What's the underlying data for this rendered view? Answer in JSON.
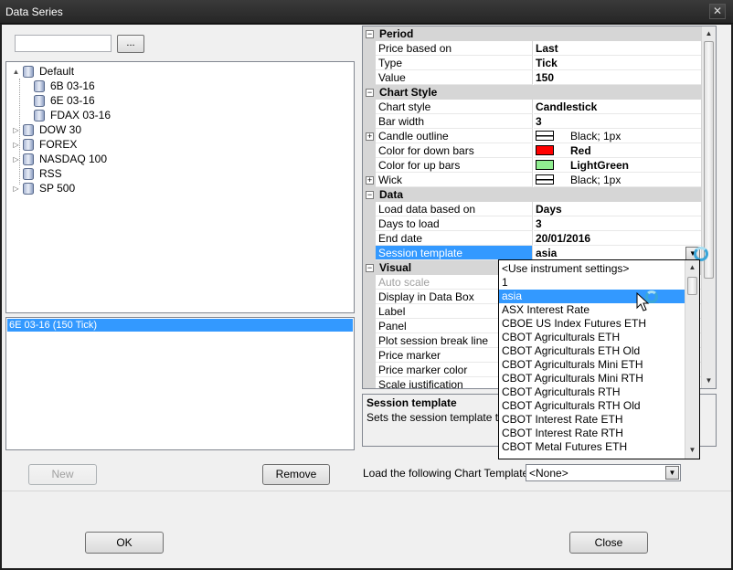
{
  "window": {
    "title": "Data Series",
    "close_glyph": "✕"
  },
  "left": {
    "search_value": "",
    "browse_label": "...",
    "tree": [
      {
        "label": "Default",
        "level": 0,
        "expander": "▲"
      },
      {
        "label": "6B 03-16",
        "level": 1,
        "expander": ""
      },
      {
        "label": "6E 03-16",
        "level": 1,
        "expander": ""
      },
      {
        "label": "FDAX 03-16",
        "level": 1,
        "expander": ""
      },
      {
        "label": "DOW 30",
        "level": 0,
        "expander": "▷"
      },
      {
        "label": "FOREX",
        "level": 0,
        "expander": "▷"
      },
      {
        "label": "NASDAQ 100",
        "level": 0,
        "expander": "▷"
      },
      {
        "label": "RSS",
        "level": 0,
        "expander": ""
      },
      {
        "label": "SP 500",
        "level": 0,
        "expander": "▷"
      }
    ],
    "selected_series": "6E 03-16 (150 Tick)",
    "new_label": "New",
    "remove_label": "Remove"
  },
  "props": {
    "period_title": "Period",
    "price_based_on": {
      "name": "Price based on",
      "value": "Last"
    },
    "type": {
      "name": "Type",
      "value": "Tick"
    },
    "value": {
      "name": "Value",
      "value": "150"
    },
    "chart_style_title": "Chart Style",
    "chart_style": {
      "name": "Chart style",
      "value": "Candlestick"
    },
    "bar_width": {
      "name": "Bar width",
      "value": "3"
    },
    "candle_outline": {
      "name": "Candle outline",
      "value": "Black; 1px"
    },
    "color_down": {
      "name": "Color for down bars",
      "value": "Red",
      "color": "#ff0000"
    },
    "color_up": {
      "name": "Color for up bars",
      "value": "LightGreen",
      "color": "#90ee90"
    },
    "wick": {
      "name": "Wick",
      "value": "Black; 1px"
    },
    "data_title": "Data",
    "load_data_based_on": {
      "name": "Load data based on",
      "value": "Days"
    },
    "days_to_load": {
      "name": "Days to load",
      "value": "3"
    },
    "end_date": {
      "name": "End date",
      "value": "20/01/2016"
    },
    "session_template": {
      "name": "Session template",
      "value": "asia"
    },
    "visual_title": "Visual",
    "auto_scale": {
      "name": "Auto scale"
    },
    "display_in_data_box": {
      "name": "Display in Data Box"
    },
    "label": {
      "name": "Label"
    },
    "panel": {
      "name": "Panel"
    },
    "plot_session_break_line": {
      "name": "Plot session break line"
    },
    "price_marker": {
      "name": "Price marker"
    },
    "price_marker_color": {
      "name": "Price marker color"
    },
    "scale_justification": {
      "name": "Scale justification"
    }
  },
  "dropdown": {
    "items": [
      "<Use instrument settings>",
      "1",
      "asia",
      "ASX Interest Rate",
      "CBOE US Index Futures ETH",
      "CBOT Agriculturals ETH",
      "CBOT Agriculturals ETH Old",
      "CBOT Agriculturals Mini ETH",
      "CBOT Agriculturals Mini RTH",
      "CBOT Agriculturals RTH",
      "CBOT Agriculturals RTH Old",
      "CBOT Interest Rate ETH",
      "CBOT Interest Rate RTH",
      "CBOT Metal Futures ETH"
    ],
    "selected_index": 2
  },
  "help": {
    "title": "Session template",
    "description": "Sets the session template to u"
  },
  "template": {
    "label": "Load the following Chart Template:",
    "value": "<None>"
  },
  "footer": {
    "ok_label": "OK",
    "close_label": "Close"
  },
  "icons": {
    "dropdown_arrow": "▼",
    "scroll_up": "▲",
    "scroll_down": "▼",
    "plus": "+",
    "minus": "−"
  }
}
